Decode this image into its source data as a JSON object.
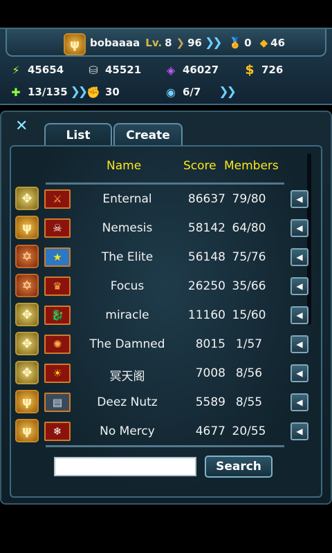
{
  "profile": {
    "emblem_icon": "wings-emblem-icon",
    "username": "bobaaaa",
    "level_label": "Lv.",
    "level": "8",
    "rank_value": "96",
    "medal_value": "0",
    "gem_value": "46"
  },
  "resources": {
    "energy": "45654",
    "metal": "45521",
    "crystal": "46027",
    "money": "726",
    "units": "13/135",
    "generals": "30",
    "missions": "6/7"
  },
  "panel": {
    "close_label": "✕",
    "tabs": [
      {
        "label": "List"
      },
      {
        "label": "Create"
      }
    ],
    "columns": {
      "name": "Name",
      "score": "Score",
      "members": "Members"
    },
    "search_placeholder": "",
    "search_label": "Search"
  },
  "guilds": [
    {
      "name": "Enternal",
      "score": "86637",
      "members": "79/80",
      "badge": "star-badge-icon",
      "flag": "banner-swords-icon"
    },
    {
      "name": "Nemesis",
      "score": "58142",
      "members": "64/80",
      "badge": "wings-badge-icon",
      "flag": "skull-crossbones-icon"
    },
    {
      "name": "The Elite",
      "score": "56148",
      "members": "75/76",
      "badge": "atom-badge-icon",
      "flag": "star-flag-icon"
    },
    {
      "name": "Focus",
      "score": "26250",
      "members": "35/66",
      "badge": "atom-badge-icon",
      "flag": "crest-icon"
    },
    {
      "name": "miracle",
      "score": "11160",
      "members": "15/60",
      "badge": "star-badge-icon",
      "flag": "dragon-icon"
    },
    {
      "name": "The Damned",
      "score": "8015",
      "members": "1/57",
      "badge": "star-badge-icon",
      "flag": "phoenix-icon"
    },
    {
      "name": "冥天阁",
      "score": "7008",
      "members": "8/56",
      "badge": "star-badge-icon",
      "flag": "sun-icon"
    },
    {
      "name": "Deez Nutz",
      "score": "5589",
      "members": "8/55",
      "badge": "wings-badge-icon",
      "flag": "book-icon"
    },
    {
      "name": "No Mercy",
      "score": "4677",
      "members": "20/55",
      "badge": "wings-badge-icon",
      "flag": "snowflake-icon"
    }
  ]
}
